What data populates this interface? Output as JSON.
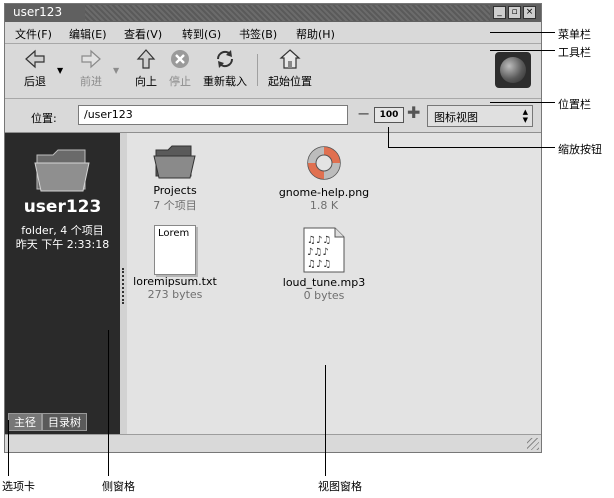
{
  "window": {
    "title": "user123"
  },
  "menubar": {
    "items": [
      "文件(F)",
      "编辑(E)",
      "查看(V)",
      "转到(G)",
      "书签(B)",
      "帮助(H)"
    ]
  },
  "toolbar": {
    "back": "后退",
    "forward": "前进",
    "up": "向上",
    "stop": "停止",
    "reload": "重新载入",
    "home": "起始位置"
  },
  "location": {
    "label": "位置:",
    "value": "/user123",
    "zoom": "100",
    "view_mode": "图标视图"
  },
  "sidepane": {
    "title": "user123",
    "meta_line1": "folder, 4 个项目",
    "meta_line2": "昨天 下午 2:33:18",
    "tabs": [
      "主径",
      "目录树"
    ]
  },
  "files": [
    {
      "name": "Projects",
      "info": "7 个项目",
      "icon": "folder-icon"
    },
    {
      "name": "gnome-help.png",
      "info": "1.8 K",
      "icon": "lifebuoy-icon"
    },
    {
      "name": "loremipsum.txt",
      "info": "273 bytes",
      "icon": "text-file-icon",
      "preview": "Lorem"
    },
    {
      "name": "loud_tune.mp3",
      "info": "0 bytes",
      "icon": "music-file-icon"
    }
  ],
  "callouts": {
    "menubar": "菜单栏",
    "toolbar": "工具栏",
    "locationbar": "位置栏",
    "zoom": "缩放按钮",
    "tab": "选项卡",
    "sidepane": "侧窗格",
    "viewpane": "视图窗格"
  },
  "colors": {
    "titlebar": "#606060",
    "sidepane": "#2a2a2a",
    "viewpane": "#e3e3e3",
    "chrome": "#d9d9d9"
  }
}
